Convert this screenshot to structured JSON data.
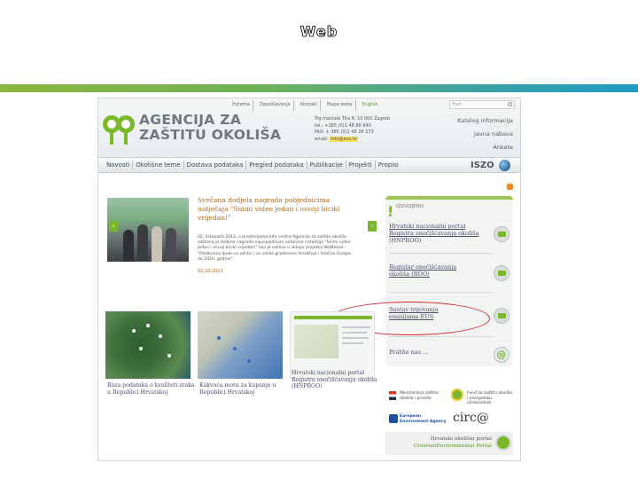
{
  "slide": {
    "title": "Web"
  },
  "colors": {
    "accent_green": "#7ab829",
    "title_orange": "#b06a1d",
    "highlight_red": "#d4262e"
  },
  "header": {
    "top_links": [
      "Početna",
      "Zapošljavanje",
      "Kontakt",
      "Mapa weba",
      "English"
    ],
    "search_placeholder": "Traži",
    "logo_line1": "AGENCIJA ZA",
    "logo_line2": "ZAŠTITU OKOLIŠA",
    "address_lines": [
      "Trg maršala Tita 8, 10 000 Zagreb",
      "tel.: +385 (0)1 48 86 840",
      "FAX: + 385 (0)1 48 26 173"
    ],
    "email_label": "email:",
    "email_value": "info@azo.hr",
    "right_links": [
      "Katalog informacija",
      "Javna nabava",
      "Ankete"
    ]
  },
  "nav": {
    "items": [
      "Novosti",
      "Okolišne teme",
      "Dostava podataka",
      "Pregled podataka",
      "Publikacije",
      "Projekti",
      "Propisi"
    ],
    "logo": "ISZO"
  },
  "feature": {
    "title": "Svečana dodjela nagrada pobjednicima natječaja \"Snimi video jedan i osvoji bicikl vrijedan!\"",
    "body": "02. listopada 2013. u prostorijama Info centra Agencije za zaštitu okoliša održana je dodjela nagrada najuspješnijim autorima natječaja \"Snimi video jedan i osvoji bicikl vrijedan!\" koji je održan u sklopu projekta NetBeeze - \"Potaknimo ljude na održiv i sa velike gradovima Središnje i Istočne Europe do 2020. godine\".",
    "date": "02.10.2013"
  },
  "right_column": {
    "heading": "IZDVOJENO",
    "items": [
      {
        "line1": "Hrvatski nacionalni portal",
        "line2": "Registra onečišćavanja okoliša",
        "line3": "(HNPROO)"
      },
      {
        "line1": "Registar onečišćavanja",
        "line2": "okoliša (ROO)"
      },
      {
        "line1": "Sustav trgovanja",
        "line2": "emisijama EUS"
      },
      {
        "line1": "Pratite nas ..."
      }
    ]
  },
  "tiles": [
    {
      "caption": "Baza podataka o kvaliteti zraka u Republici Hrvatskoj"
    },
    {
      "caption": "Kakvoća mora za kupanje u Republici Hrvatskoj"
    },
    {
      "caption": "Hrvatski nacionalni portal Registra onečišćavanja okoliša (HNPROO)"
    }
  ],
  "partners": {
    "ministry": "Ministarstvo zaštite okoliša i prirode",
    "fund": "Fond za zaštitu okoliša i energetsku učinkovitost",
    "eea_line1": "European",
    "eea_line2": "Environment Agency",
    "circa": "circ@",
    "portal_line1": "Hrvatski okolišni portal",
    "portal_line2": "CroatianEnvironmental Portal"
  }
}
